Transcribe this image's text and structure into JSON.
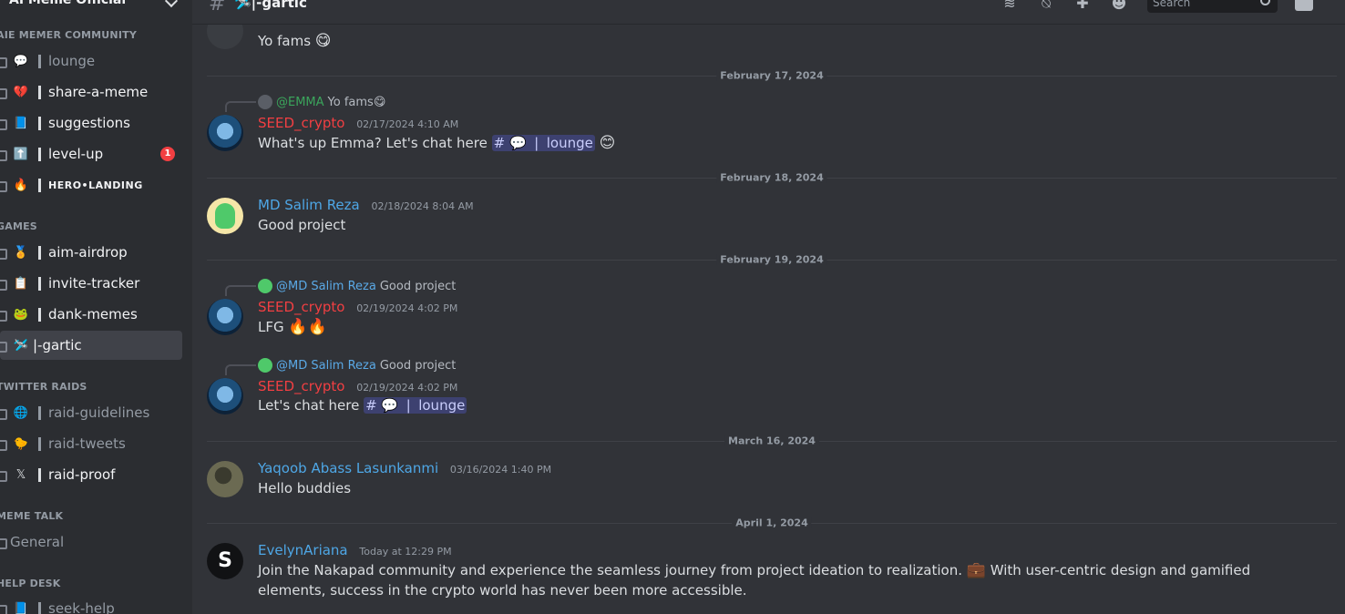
{
  "server": {
    "name": "AI Meme Official"
  },
  "header": {
    "channel_title": "🛩️|-gartic",
    "search_placeholder": "Search"
  },
  "sidebar": {
    "categories": [
      {
        "label": "AIE MEMER COMMUNITY"
      },
      {
        "label": "GAMES"
      },
      {
        "label": "TWITTER RAIDS"
      },
      {
        "label": "MEME TALK"
      },
      {
        "label": "HELP DESK"
      }
    ],
    "channels": [
      {
        "emoji": "💬",
        "name": "lounge"
      },
      {
        "emoji": "💔",
        "name": "share-a-meme"
      },
      {
        "emoji": "📘",
        "name": "suggestions"
      },
      {
        "emoji": "⬆️",
        "name": "level-up",
        "badge": "1"
      },
      {
        "emoji": "🔥",
        "name": "HERO•LANDING"
      },
      {
        "emoji": "🏅",
        "name": "aim-airdrop"
      },
      {
        "emoji": "📋",
        "name": "invite-tracker"
      },
      {
        "emoji": "🐸",
        "name": "dank-memes"
      },
      {
        "emoji": "🛩️",
        "name": "|-gartic"
      },
      {
        "emoji": "🌐",
        "name": "raid-guidelines"
      },
      {
        "emoji": "🐤",
        "name": "raid-tweets"
      },
      {
        "emoji": "𝕏",
        "name": "raid-proof"
      },
      {
        "emoji": "",
        "name": "General"
      },
      {
        "emoji": "📘",
        "name": "seek-help"
      }
    ]
  },
  "messages": {
    "m0": {
      "text": "Yo fams",
      "emoji": "😋"
    },
    "dividers": [
      "February 17, 2024",
      "February 18, 2024",
      "February 19, 2024",
      "March 16, 2024",
      "April 1, 2024"
    ],
    "m1": {
      "reply_name": "@EMMA",
      "reply_text": "Yo fams",
      "reply_emoji": "😋",
      "author": "SEED_crypto",
      "ts": "02/17/2024 4:10 AM",
      "text": "What's up Emma? Let's chat here",
      "mention": "# 💬 ❘ lounge",
      "emoji": "😊"
    },
    "m2": {
      "author": "MD Salim Reza",
      "ts": "02/18/2024 8:04 AM",
      "text": "Good project"
    },
    "m3": {
      "reply_name": "@MD Salim Reza",
      "reply_text": "Good project",
      "author": "SEED_crypto",
      "ts": "02/19/2024 4:02 PM",
      "text": "LFG",
      "emoji": "🔥🔥"
    },
    "m4": {
      "reply_name": "@MD Salim Reza",
      "reply_text": "Good project",
      "author": "SEED_crypto",
      "ts": "02/19/2024 4:02 PM",
      "text": "Let's chat here",
      "mention": "# 💬 ❘ lounge"
    },
    "m5": {
      "author": "Yaqoob Abass Lasunkanmi",
      "ts": "03/16/2024 1:40 PM",
      "text": "Hello buddies"
    },
    "m6": {
      "author": "EvelynAriana",
      "ts": "Today at 12:29 PM",
      "text1": "Join the Nakapad community and experience the seamless journey from project ideation to realization.",
      "emoji": "💼",
      "text2": "With user-centric design and gamified elements, success in the crypto world has never been more accessible."
    }
  }
}
